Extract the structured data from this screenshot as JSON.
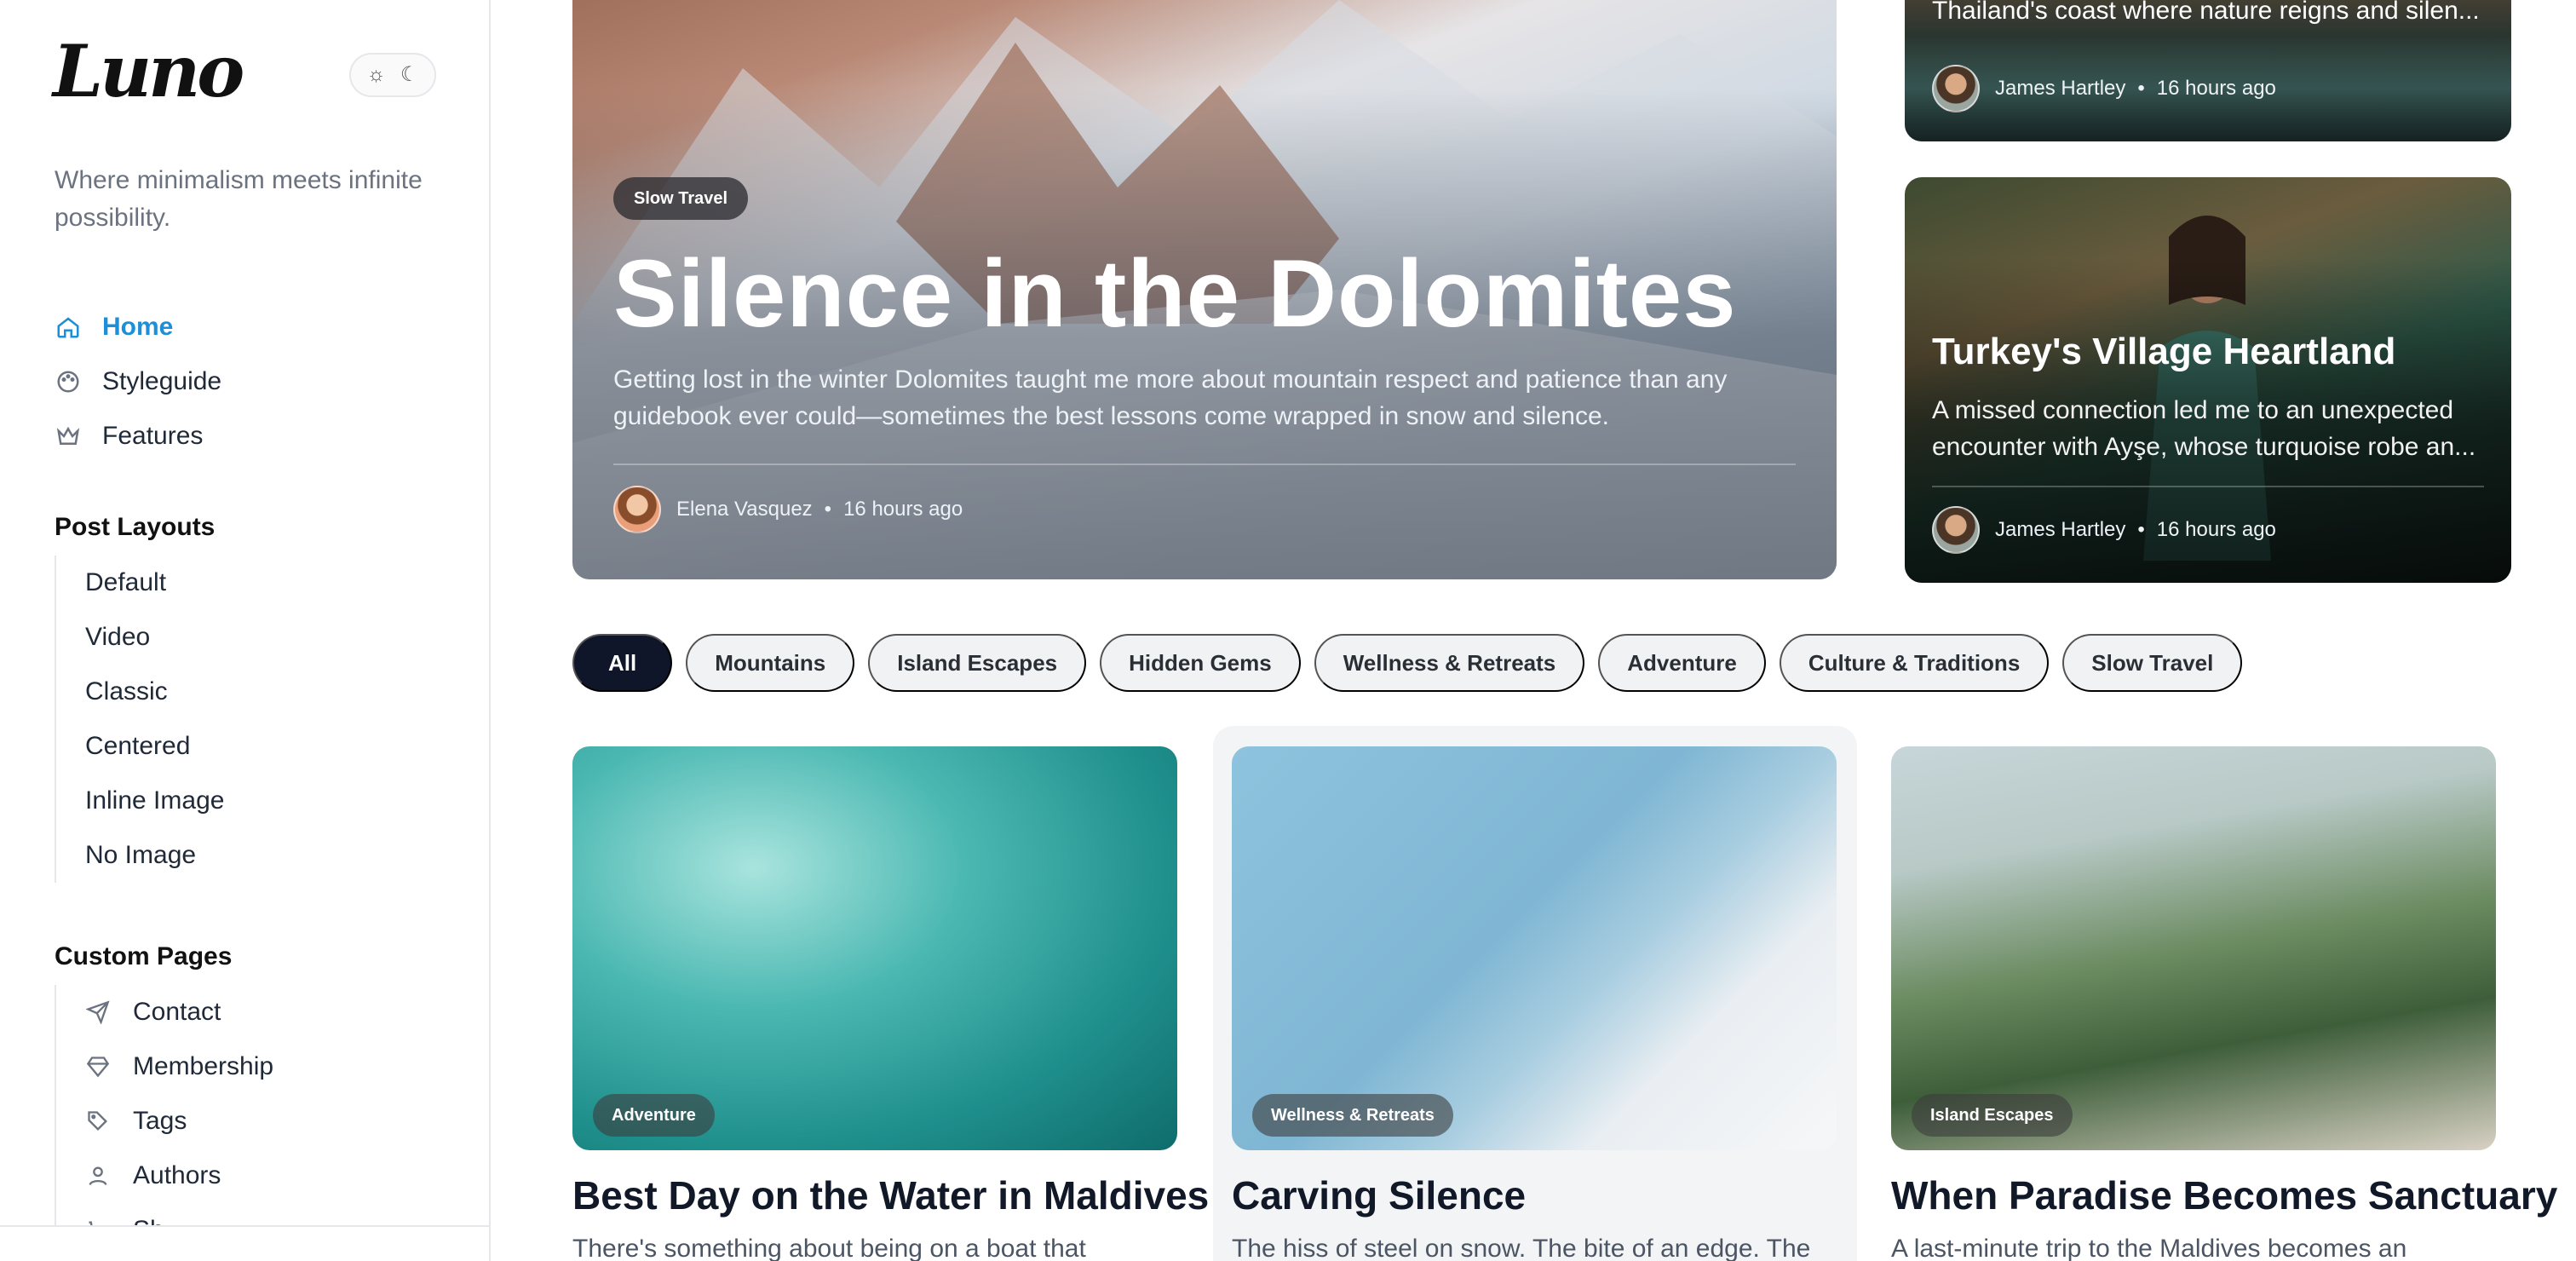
{
  "brand": {
    "logo": "Luno",
    "tagline": "Where minimalism meets infinite possibility."
  },
  "nav": [
    {
      "label": "Home",
      "icon": "home-icon",
      "active": true
    },
    {
      "label": "Styleguide",
      "icon": "palette-icon",
      "active": false
    },
    {
      "label": "Features",
      "icon": "crown-icon",
      "active": false
    }
  ],
  "post_layouts": {
    "title": "Post Layouts",
    "items": [
      "Default",
      "Video",
      "Classic",
      "Centered",
      "Inline Image",
      "No Image"
    ]
  },
  "custom_pages": {
    "title": "Custom Pages",
    "items": [
      {
        "label": "Contact",
        "icon": "send-icon"
      },
      {
        "label": "Membership",
        "icon": "diamond-icon"
      },
      {
        "label": "Tags",
        "icon": "tag-icon"
      },
      {
        "label": "Authors",
        "icon": "user-icon"
      },
      {
        "label": "Sh...",
        "icon": "cart-icon"
      }
    ]
  },
  "hero": {
    "tag": "Slow Travel",
    "title": "Silence in the Dolomites",
    "excerpt": "Getting lost in the winter Dolomites taught me more about mountain respect and patience than any guidebook ever could—sometimes the best lessons come wrapped in snow and silence.",
    "author": "Elena Vasquez",
    "time": "16 hours ago"
  },
  "side_cards": {
    "top": {
      "excerpt": "Thailand's coast where nature reigns and silen...",
      "author": "James Hartley",
      "time": "16 hours ago"
    },
    "turkey": {
      "title": "Turkey's Village Heartland",
      "excerpt": "A missed connection led me to an unexpected encounter with Ayşe, whose turquoise robe an...",
      "author": "James Hartley",
      "time": "16 hours ago"
    }
  },
  "filters": [
    "All",
    "Mountains",
    "Island Escapes",
    "Hidden Gems",
    "Wellness & Retreats",
    "Adventure",
    "Culture & Traditions",
    "Slow Travel"
  ],
  "posts": [
    {
      "tag": "Adventure",
      "title": "Best Day on the Water in Maldives",
      "excerpt": "There's something about being on a boat that"
    },
    {
      "tag": "Wellness & Retreats",
      "title": "Carving Silence",
      "excerpt": "The hiss of steel on snow. The bite of an edge. The"
    },
    {
      "tag": "Island Escapes",
      "title": "When Paradise Becomes Sanctuary",
      "excerpt": "A last-minute trip to the Maldives becomes an"
    }
  ],
  "meta_separator": "•",
  "colors": {
    "accent": "#1d8fd8",
    "active_pill": "#0f1629"
  }
}
